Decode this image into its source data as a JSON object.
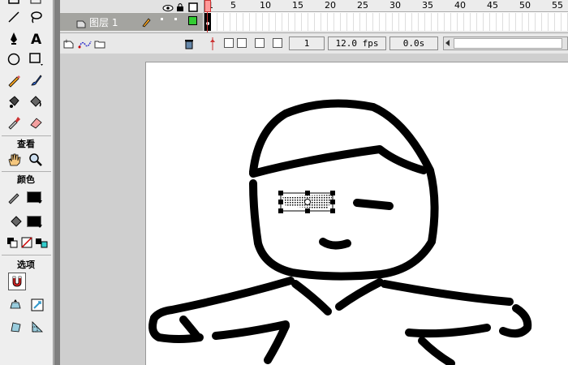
{
  "tools_panel": {
    "view_title": "查看",
    "colors_title": "颜色",
    "options_title": "选项",
    "stroke_color": "#000000",
    "fill_color": "#000000"
  },
  "timeline": {
    "layer_name": "图层 1",
    "ruler_numbers": [
      "1",
      "5",
      "10",
      "15",
      "20",
      "25",
      "30",
      "35",
      "40",
      "45",
      "50",
      "55"
    ],
    "current_frame": "1",
    "frame_rate": "12.0 fps",
    "elapsed_time": "0.0s"
  },
  "colors": {
    "stage": "#ffffff",
    "workspace": "#cfcfcf",
    "layer_row": "#a4a4a0",
    "playhead": "#cc3333",
    "layer_swatch": "#33cc33"
  }
}
